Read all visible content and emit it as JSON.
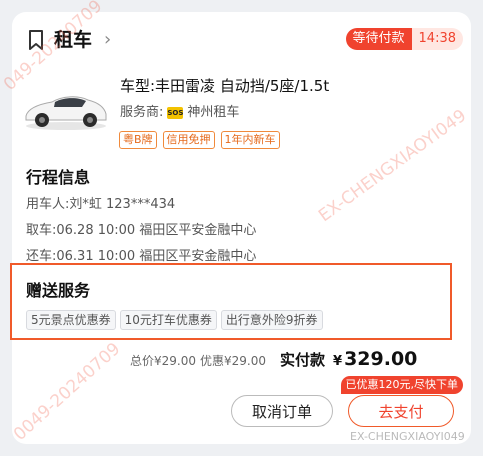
{
  "header": {
    "title": "租车",
    "chevron": "›",
    "status_label": "等待付款",
    "countdown": "14:38",
    "icon": "bookmark-icon"
  },
  "car": {
    "model": "车型:丰田雷凌 自动挡/5座/1.5t",
    "vendor_label": "服务商:",
    "vendor_logo_text": "SOS",
    "vendor_name": "神州租车",
    "tags": [
      "粤B牌",
      "信用免押",
      "1年内新车"
    ]
  },
  "trip": {
    "title": "行程信息",
    "user": "用车人:刘*虹 123***434",
    "pickup": "取车:06.28 10:00 福田区平安金融中心",
    "return": "还车:06.31 10:00 福田区平安金融中心"
  },
  "gifts": {
    "title": "赠送服务",
    "items": [
      "5元景点优惠券",
      "10元打车优惠券",
      "出行意外险9折券"
    ]
  },
  "price": {
    "total": "总价¥29.00",
    "discount": "优惠¥29.00",
    "pay_label": "实付款",
    "currency": "¥",
    "amount": "329.00",
    "promo": "已优惠120元,尽快下单"
  },
  "actions": {
    "cancel": "取消订单",
    "pay": "去支付"
  },
  "watermarks": {
    "a": "049-20240709",
    "b": "EX-CHENGXIAOYI049",
    "c": "0049-20240709",
    "d": "EX-CHENGXIAOYI049"
  },
  "colors": {
    "accent": "#f0432e",
    "tag": "#e56a1c"
  }
}
